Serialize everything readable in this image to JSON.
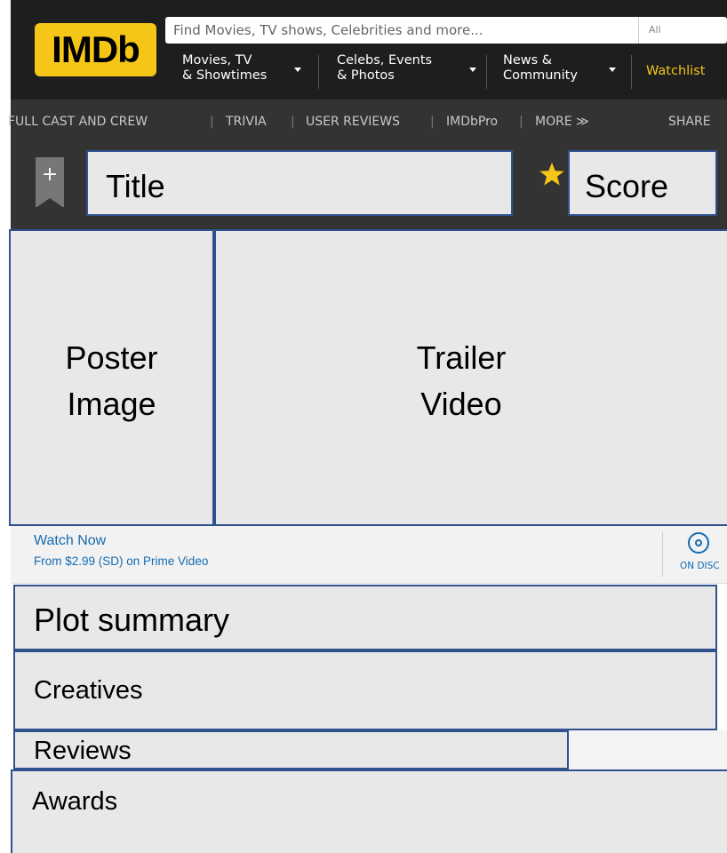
{
  "header": {
    "logo_text": "IMDb",
    "search_placeholder": "Find Movies, TV shows, Celebrities and more...",
    "search_scope": "All",
    "nav": [
      {
        "line1": "Movies, TV",
        "line2": "& Showtimes"
      },
      {
        "line1": "Celebs, Events",
        "line2": "& Photos"
      },
      {
        "line1": "News &",
        "line2": "Community"
      }
    ],
    "watchlist": "Watchlist"
  },
  "subnav": {
    "items": [
      "FULL CAST AND CREW",
      "TRIVIA",
      "USER REVIEWS",
      "IMDbPro",
      "MORE ≫"
    ],
    "share": "SHARE"
  },
  "title_bar": {
    "add_icon": "+",
    "title": "Title",
    "score": "Score"
  },
  "media": {
    "poster": "Poster Image",
    "trailer": "Trailer Video"
  },
  "watch_now": {
    "title": "Watch Now",
    "subtitle": "From $2.99 (SD) on Prime Video",
    "disc_label": "ON DISC"
  },
  "sections": {
    "plot": "Plot summary",
    "creatives": "Creatives",
    "reviews": "Reviews",
    "awards": "Awards"
  },
  "colors": {
    "brand_yellow": "#f5c518",
    "link_blue": "#136cb2",
    "placeholder_border": "#2f528f",
    "placeholder_fill": "#e8e8e8"
  }
}
